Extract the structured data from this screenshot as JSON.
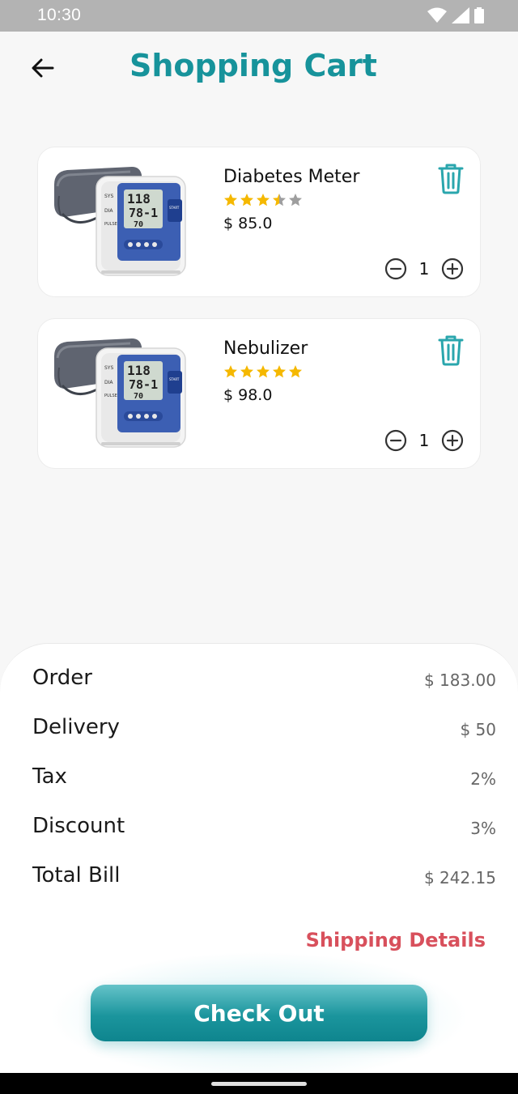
{
  "status_bar": {
    "time": "10:30"
  },
  "header": {
    "title": "Shopping Cart"
  },
  "theme": {
    "accent": "#17939b",
    "link": "#d8505c",
    "star": "#f5b800",
    "star_empty": "#9e9e9e"
  },
  "cart": {
    "items": [
      {
        "name": "Diabetes Meter",
        "rating": 3.5,
        "price": "$ 85.0",
        "quantity": "1",
        "image": "blood-pressure-monitor"
      },
      {
        "name": "Nebulizer",
        "rating": 5,
        "price": "$ 98.0",
        "quantity": "1",
        "image": "blood-pressure-monitor"
      }
    ]
  },
  "summary": {
    "rows": [
      {
        "label": "Order",
        "value": "$ 183.00"
      },
      {
        "label": "Delivery",
        "value": "$ 50"
      },
      {
        "label": "Tax",
        "value": "2%"
      },
      {
        "label": "Discount",
        "value": "3%"
      },
      {
        "label": "Total Bill",
        "value": "$ 242.15"
      }
    ],
    "shipping_link": "Shipping Details",
    "checkout_label": "Check Out"
  }
}
